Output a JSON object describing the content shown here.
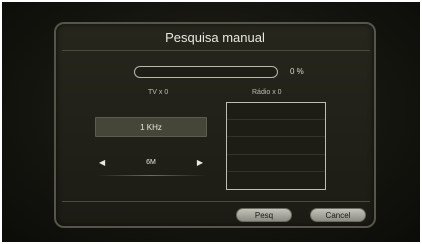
{
  "dialog": {
    "title": "Pesquisa manual"
  },
  "progress": {
    "value_percent": 0,
    "label": "0  %"
  },
  "counts": {
    "tv_label": "TV x 0",
    "radio_label": "Rádio x 0"
  },
  "frequency": {
    "value": "1 KHz"
  },
  "bandwidth": {
    "value": "6M",
    "left_arrow": "◀",
    "right_arrow": "▶"
  },
  "radio_list": {
    "items": [
      "",
      "",
      "",
      "",
      ""
    ]
  },
  "buttons": {
    "search_label": "Pesq",
    "cancel_label": "Cancel"
  },
  "colors": {
    "accent": "#c3c3ba",
    "background": "#1c1c15"
  }
}
